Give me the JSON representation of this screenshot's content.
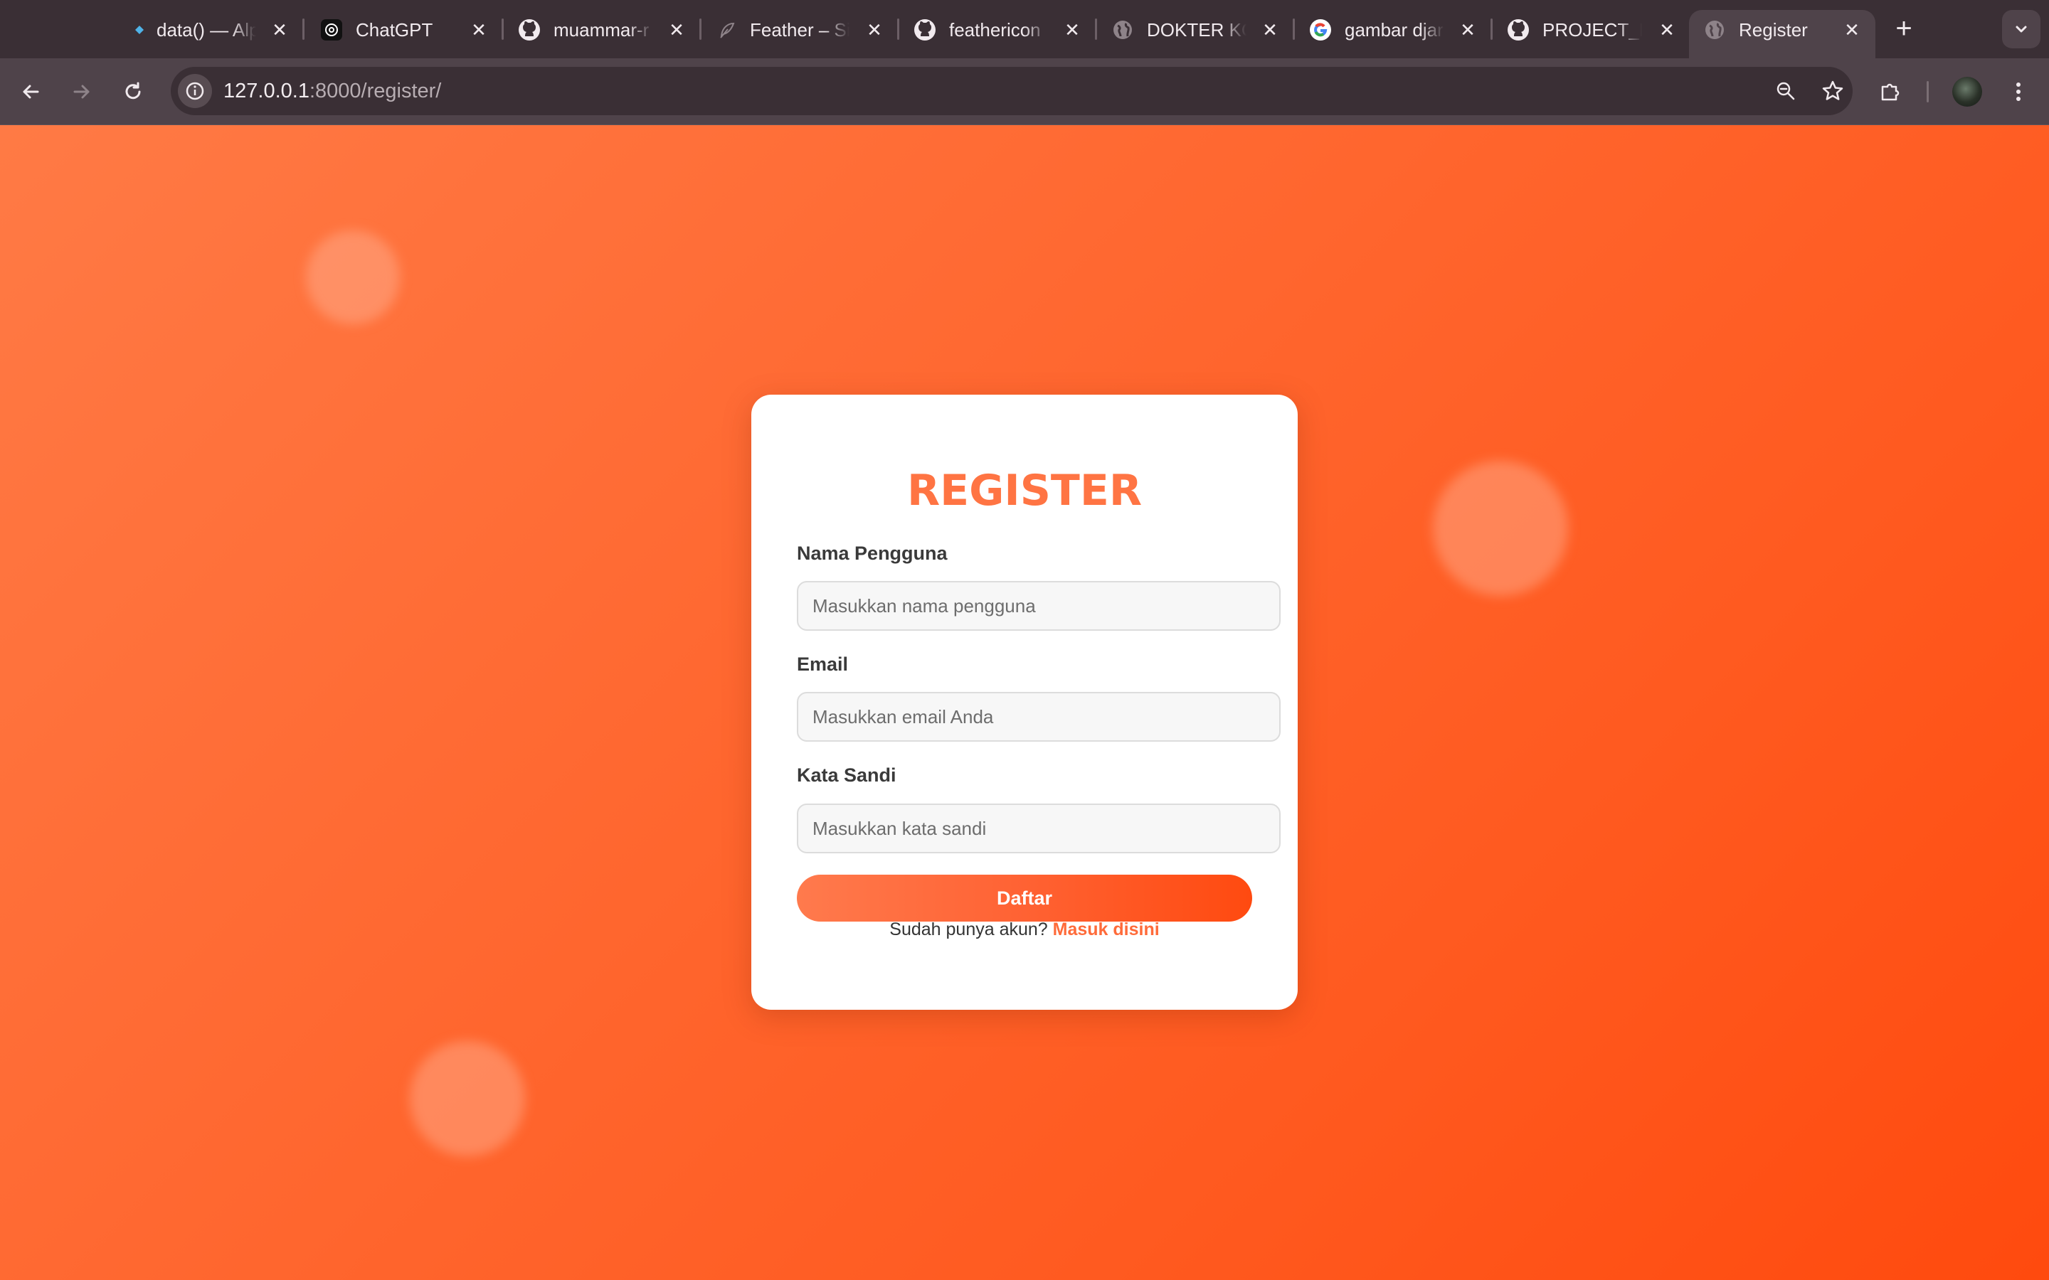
{
  "browser": {
    "tabs": [
      {
        "title": "data() — Alp",
        "favicon": "diamond-icon"
      },
      {
        "title": "ChatGPT",
        "favicon": "chatgpt-icon"
      },
      {
        "title": "muammar-r",
        "favicon": "github-icon"
      },
      {
        "title": "Feather – Si",
        "favicon": "feather-icon"
      },
      {
        "title": "feathericon",
        "favicon": "github-icon"
      },
      {
        "title": "DOKTER KC",
        "favicon": "globe-icon"
      },
      {
        "title": "gambar djar",
        "favicon": "google-icon"
      },
      {
        "title": "PROJECT_E",
        "favicon": "github-icon"
      },
      {
        "title": "Register",
        "favicon": "globe-icon",
        "active": true
      }
    ],
    "url_host": "127.0.0.1",
    "url_path": ":8000/register/"
  },
  "page": {
    "title": "REGISTER",
    "username_label": "Nama Pengguna",
    "username_placeholder": "Masukkan nama pengguna",
    "email_label": "Email",
    "email_placeholder": "Masukkan email Anda",
    "password_label": "Kata Sandi",
    "password_placeholder": "Masukkan kata sandi",
    "submit_label": "Daftar",
    "login_prompt": "Sudah punya akun?",
    "login_link": "Masuk disini"
  },
  "colors": {
    "accent": "#ff7443",
    "background_start": "#ff7a45",
    "background_end": "#ff4a0e"
  }
}
